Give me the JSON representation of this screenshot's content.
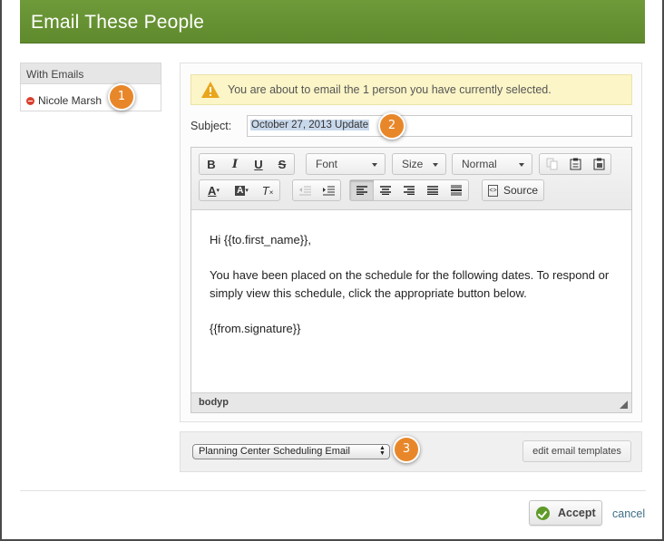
{
  "dialog": {
    "title": "Email These People",
    "accent_color": "#659336"
  },
  "recipients": {
    "header": "With Emails",
    "items": [
      {
        "name": "Nicole Marsh"
      }
    ]
  },
  "callouts": [
    "1",
    "2",
    "3"
  ],
  "warning": {
    "text": "You are about to email the 1 person you have currently selected."
  },
  "subject": {
    "label": "Subject:",
    "value": "October 27, 2013 Update"
  },
  "editor": {
    "toolbar": {
      "bold": "B",
      "italic": "I",
      "underline": "U",
      "strike": "S",
      "font_combo": "Font",
      "size_combo": "Size",
      "format_combo": "Normal",
      "text_color": "A",
      "bg_color": "A",
      "remove_format": "T",
      "source": "Source"
    },
    "body": {
      "greeting": "Hi {{to.first_name}},",
      "paragraph": "You have been placed on the schedule for the following dates. To respond or simply view this schedule, click the appropriate button below.",
      "signature": "{{from.signature}}"
    },
    "status_path": "bodyp"
  },
  "template": {
    "selected": "Planning Center Scheduling Email",
    "edit_label": "edit email templates"
  },
  "actions": {
    "accept_label": "Accept",
    "cancel_label": "cancel"
  }
}
